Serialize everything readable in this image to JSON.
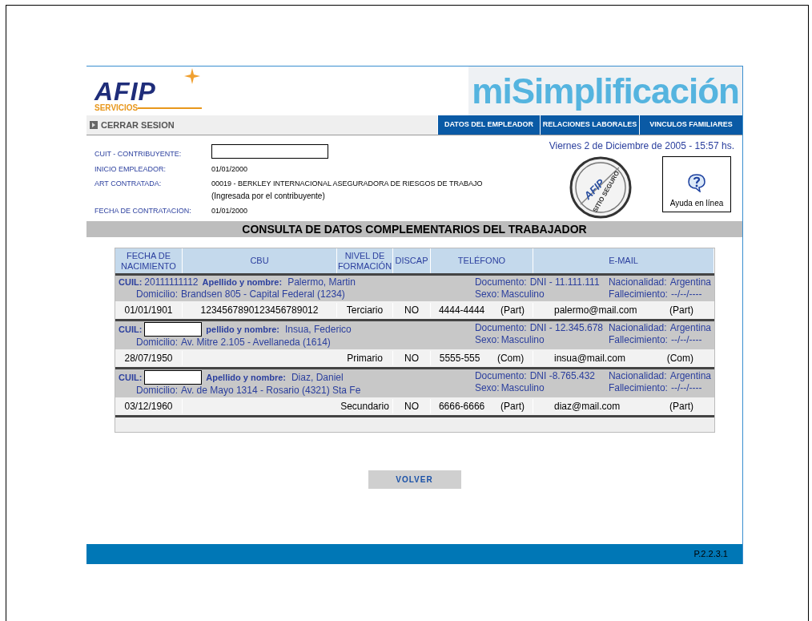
{
  "header": {
    "logo": {
      "letters": "AFIP",
      "subtitle": "SERVICIOS"
    },
    "brand": "miSimplificación"
  },
  "nav": {
    "logout": "CERRAR SESION",
    "tabs": [
      "DATOS DEL EMPLEADOR",
      "RELACIONES LABORALES",
      "VINCULOS FAMILIARES"
    ]
  },
  "info": {
    "date": "Viernes 2 de Diciembre de 2005 - 15:57 hs.",
    "fields": [
      {
        "kind": "input",
        "label": "CUIT - CONTRIBUYENTE:"
      },
      {
        "kind": "text",
        "label": "INICIO EMPLEADOR:",
        "value": "01/01/2000"
      },
      {
        "kind": "text",
        "label": "ART CONTRATADA:",
        "value": "00019 - BERKLEY INTERNACIONAL ASEGURADORA DE RIESGOS DE TRABAJO",
        "note": "(Ingresada por el contribuyente)"
      },
      {
        "kind": "text",
        "label": "FECHA DE CONTRATACION:",
        "value": "01/01/2000"
      }
    ],
    "seal": {
      "logo": "AFIP",
      "caption": "SITIO SEGURO"
    },
    "help": "Ayuda en línea"
  },
  "title": "CONSULTA DE DATOS COMPLEMENTARIOS DEL TRABAJADOR",
  "table": {
    "columns": [
      "FECHA DE NACIMIENTO",
      "CBU",
      "NIVEL DE FORMACIÓN",
      "DISCAP",
      "TELÉFONO",
      "E-MAIL"
    ],
    "workers": [
      {
        "cuil_label": "CUIL:",
        "cuil": "20111111112",
        "name_label": "Apellido y nombre:",
        "name": "Palermo, Martin",
        "domicilio_label": "Domicilio:",
        "domicilio": "Brandsen 805 - Capital Federal (1234)",
        "documento_label": "Documento:",
        "documento": "DNI - 11.111.111",
        "sexo_label": "Sexo:",
        "sexo": "Masculino",
        "nacionalidad_label": "Nacionalidad:",
        "nacionalidad": "Argentina",
        "fallecimiento_label": "Fallecimiento:",
        "fallecimiento": "--/--/----",
        "fecha": "01/01/1901",
        "cbu": "1234567890123456789012",
        "nivel": "Terciario",
        "discap": "NO",
        "telefono": "4444-4444",
        "telefono_tipo": "(Part)",
        "email": "palermo@mail.com",
        "email_tipo": "(Part)"
      },
      {
        "cuil_label": "CUIL:",
        "name_label": "pellido y nombre:",
        "name": "Insua, Federico",
        "domicilio_label": "Domicilio:",
        "domicilio": "Av. Mitre 2.105 - Avellaneda (1614)",
        "documento_label": "Documento:",
        "documento": "DNI - 12.345.678",
        "sexo_label": "Sexo:",
        "sexo": "Masculino",
        "nacionalidad_label": "Nacionalidad:",
        "nacionalidad": "Argentina",
        "fallecimiento_label": "Fallecimiento:",
        "fallecimiento": "--/--/----",
        "fecha": "28/07/1950",
        "nivel": "Primario",
        "discap": "NO",
        "telefono": "5555-555",
        "telefono_tipo": "(Com)",
        "email": "insua@mail.com",
        "email_tipo": "(Com)"
      },
      {
        "cuil_label": "CUIL:",
        "name_label": "Apellido y nombre:",
        "name": "Diaz, Daniel",
        "domicilio_label": "Domicilio:",
        "domicilio": "Av. de Mayo 1314 - Rosario (4321) Sta Fe",
        "documento_label": "Documento:",
        "documento": "DNI -8.765.432",
        "sexo_label": "Sexo:",
        "sexo": "Masculino",
        "nacionalidad_label": "Nacionalidad:",
        "nacionalidad": "Argentina",
        "fallecimiento_label": "Fallecimiento:",
        "fallecimiento": "--/--/----",
        "fecha": "03/12/1960",
        "nivel": "Secundario",
        "discap": "NO",
        "telefono": "6666-6666",
        "telefono_tipo": "(Part)",
        "email": "diaz@mail.com",
        "email_tipo": "(Part)"
      }
    ]
  },
  "button": "VOLVER",
  "footer": "P.2.2.3.1"
}
